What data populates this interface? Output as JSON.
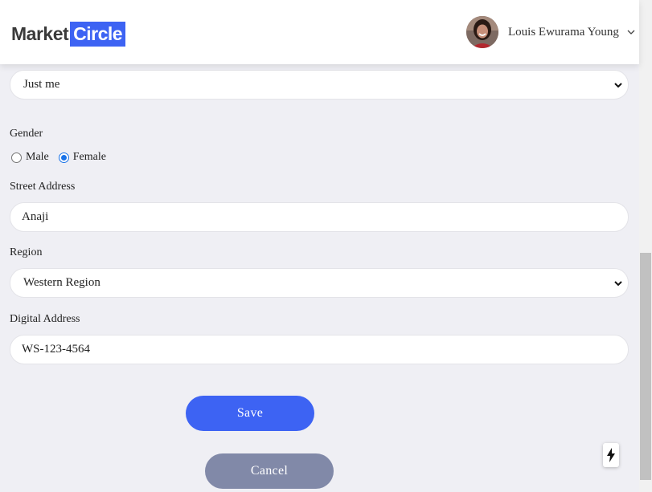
{
  "header": {
    "logo": {
      "part1": "Market",
      "part2": "Circle"
    },
    "user": {
      "name": "Louis Ewurama Young"
    }
  },
  "form": {
    "household_select": {
      "value": "Just me"
    },
    "gender": {
      "label": "Gender",
      "options": [
        {
          "label": "Male",
          "checked": false
        },
        {
          "label": "Female",
          "checked": true
        }
      ]
    },
    "street_address": {
      "label": "Street Address",
      "value": "Anaji"
    },
    "region": {
      "label": "Region",
      "value": "Western Region"
    },
    "digital_address": {
      "label": "Digital Address",
      "value": "WS-123-4564"
    },
    "save_label": "Save",
    "cancel_label": "Cancel"
  },
  "colors": {
    "accent": "#3d63f3",
    "cancel": "#8189a8",
    "background": "#efeff4",
    "radio_checked": "#1a73e8"
  },
  "icons": {
    "user_menu": "chevron-down-icon",
    "select_arrow": "chevron-down-icon",
    "fab": "lightning-bolt-icon"
  }
}
